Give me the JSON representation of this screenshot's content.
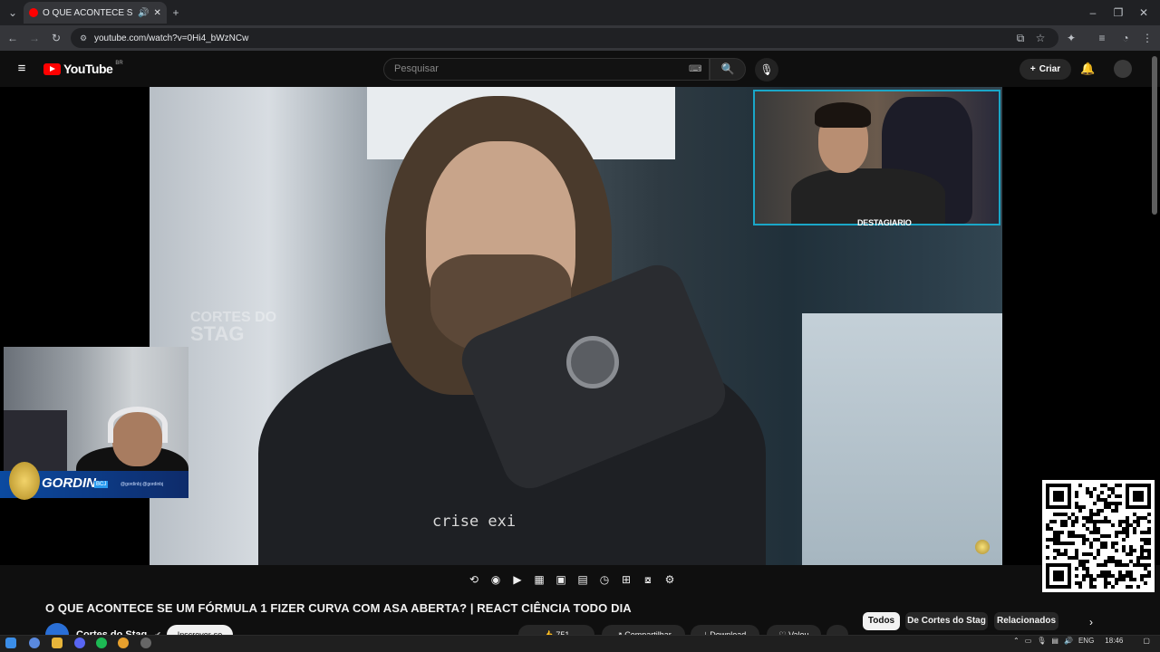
{
  "browser": {
    "tab_title": "O QUE ACONTECE SE UM F",
    "url": "youtube.com/watch?v=0Hi4_bWzNCw",
    "tab_audio_icon": "speaker-icon"
  },
  "youtube": {
    "logo_text": "YouTube",
    "country_code": "BR",
    "search_placeholder": "Pesquisar",
    "create_label": "Criar"
  },
  "video": {
    "watermark_line1": "CORTES DO",
    "watermark_line2": "STAG",
    "shirt_text": "crise exi",
    "pip_label": "DESTAGIARIO",
    "cam_name": "GORDIN",
    "cam_tag": "BCJ",
    "cam_social": "@gordinbj  @gordinbj"
  },
  "info": {
    "title": "O QUE ACONTECE SE UM FÓRMULA 1 FIZER CURVA COM ASA ABERTA? | REACT CIÊNCIA TODO DIA",
    "channel": "Cortes do Stag",
    "subscribe": "Inscrever-se",
    "likes": "751",
    "share": "Compartilhar",
    "download": "Download",
    "thanks": "Valeu"
  },
  "chips": [
    "Todos",
    "De Cortes do Stag",
    "Relacionados"
  ],
  "taskbar": {
    "lang": "ENG",
    "time": "18:46"
  },
  "colors": {
    "youtube_red": "#ff0000",
    "pip_border": "#1aa7c8",
    "name_bar": "#0b4aa0"
  }
}
